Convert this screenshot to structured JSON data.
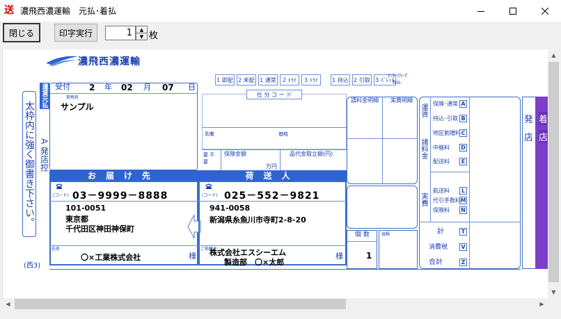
{
  "window": {
    "app_icon_char": "送",
    "title": "濃飛西濃運輸　元払･着払"
  },
  "toolbar": {
    "close_label": "閉じる",
    "print_label": "印字実行",
    "copies_value": "1",
    "copies_unit": "枚"
  },
  "slip": {
    "company_logo": "濃飛西濃運輸",
    "side_bar_label": "運賃元払",
    "vertical_notice": "太枠内に強く御書き下さい。",
    "branch_control": "A 発店控",
    "footer_code": "(西3)",
    "service_tabs": [
      "1 即配",
      "2 未配",
      "1 通常",
      "2 ﾄﾗｲ",
      "3 ﾄﾗｲ",
      "1 持込",
      "2 引取",
      "3 ﾊﾟﾚｯﾄ"
    ],
    "service_sub_label": "ｾﾝﾀｰﾜﾘｰｸ",
    "no_label": "No.",
    "receipt": {
      "label": "受付",
      "year": "2",
      "year_unit": "年",
      "month": "02",
      "month_unit": "月",
      "day": "07",
      "day_unit": "日",
      "small_label": "荷物名",
      "item_name": "サンプル"
    },
    "center_labels": {
      "shiwake_code": "仕 分 コ ー ド",
      "arrival_label": "到着",
      "price_label": "価格",
      "insured_label": "保険金額",
      "currency": "万円",
      "cod_label": "品代金取立額(円)",
      "insurance_side": "要 不要"
    },
    "deliver_bar": "お届け先",
    "sender_bar": "荷送人",
    "consignee": {
      "phone_label": "(コード)",
      "phone": "03－9999－8888",
      "zip": "101-0051",
      "address1": "東京都",
      "address2": "千代田区神田神保町",
      "name_label": "氏名",
      "name": "〇×工業株式会社",
      "honorific": "様"
    },
    "shipper": {
      "phone_label": "(コード)",
      "phone": "025－552－9821",
      "zip": "941-0058",
      "address": "新潟県糸魚川市寺町2-8-20",
      "name_label": "ご依頼主",
      "company": "株式会社エスシーエム",
      "person": "製造部　〇×太郎",
      "honorific": "様"
    },
    "piece_count_label": "個 数",
    "piece_count": "1",
    "weight_label": "容積",
    "right_panel": {
      "billing_label": "請料金明細",
      "actual_label": "実費明細",
      "columns": [
        "運賃",
        "諸料金",
        "実費"
      ],
      "rows": [
        {
          "label": "保険･通常",
          "code": "A"
        },
        {
          "label": "持込･引取",
          "code": "B"
        },
        {
          "label": "地区割増料",
          "code": "C"
        },
        {
          "label": "中継料",
          "code": "D"
        },
        {
          "label": "配送料",
          "code": "E"
        },
        {
          "label": "航送料",
          "code": "L"
        },
        {
          "label": "代引手数料",
          "code": "M"
        },
        {
          "label": "保険料",
          "code": "N"
        },
        {
          "label": "計",
          "code": "T"
        },
        {
          "label": "消費税",
          "code": "V"
        },
        {
          "label": "合計",
          "code": "Z"
        }
      ],
      "side_labels": [
        "発",
        "店"
      ],
      "edge_labels": [
        "着",
        "店"
      ]
    }
  }
}
